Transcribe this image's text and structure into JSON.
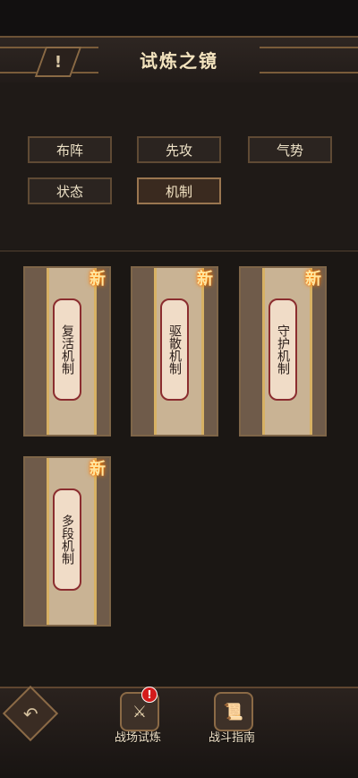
{
  "header": {
    "title": "试炼之镜",
    "info_icon": "info-icon",
    "info_symbol": "!"
  },
  "tabs": [
    {
      "label": "布阵",
      "active": false
    },
    {
      "label": "先攻",
      "active": false
    },
    {
      "label": "气势",
      "active": false
    },
    {
      "label": "状态",
      "active": false
    },
    {
      "label": "机制",
      "active": true
    }
  ],
  "cards": [
    {
      "label": "复活机制",
      "badge": "新"
    },
    {
      "label": "驱散机制",
      "badge": "新"
    },
    {
      "label": "守护机制",
      "badge": "新"
    },
    {
      "label": "多段机制",
      "badge": "新"
    }
  ],
  "bottom_nav": {
    "back_icon": "back-arrow-icon",
    "back_glyph": "↶",
    "items": [
      {
        "label": "战场试炼",
        "icon": "helmet-icon",
        "glyph": "⚔",
        "alert": "!"
      },
      {
        "label": "战斗指南",
        "icon": "scroll-book-icon",
        "glyph": "📜"
      }
    ]
  },
  "colors": {
    "accent_gold": "#d7b164",
    "badge_glow": "#ff8c00",
    "alert_red": "#d41b1b"
  }
}
